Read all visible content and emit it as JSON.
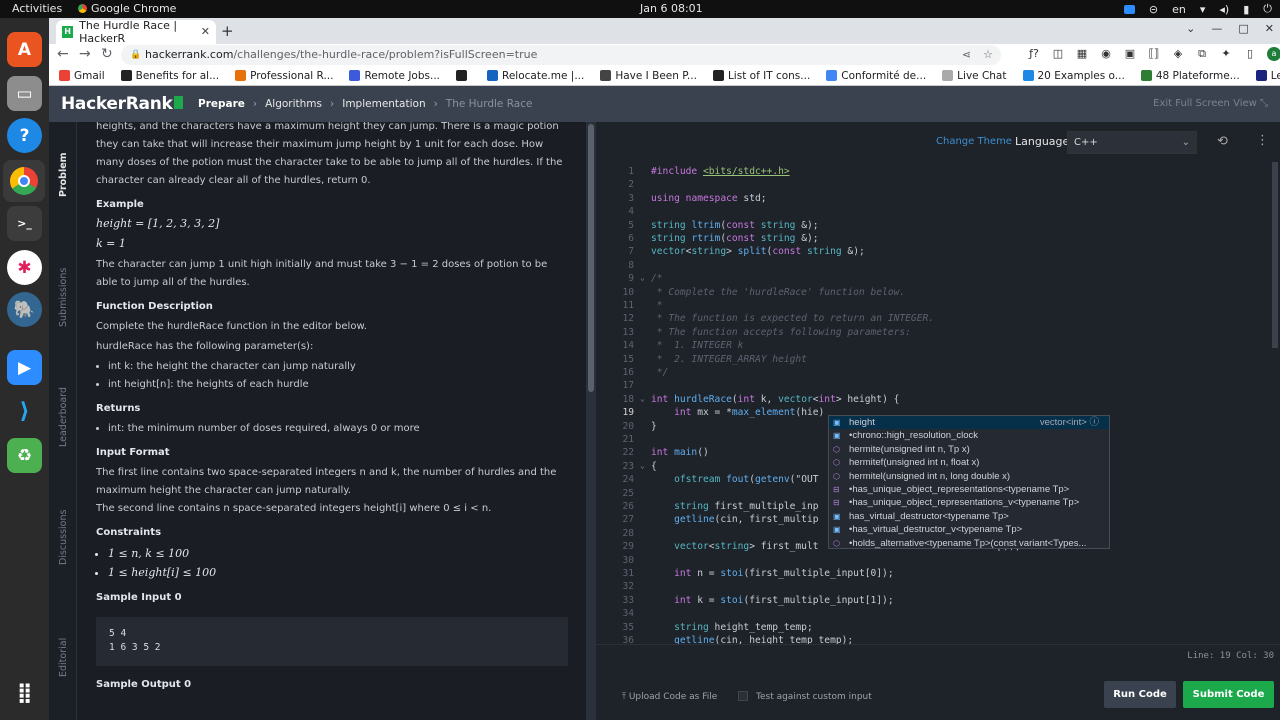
{
  "system_bar": {
    "activities": "Activities",
    "app_name": "Google Chrome",
    "clock": "Jan 6  08:01",
    "locale": "en"
  },
  "dock": {
    "items": [
      "ubuntu-software",
      "files",
      "help",
      "chrome",
      "terminal",
      "slack",
      "postgres",
      "zoom",
      "vscode",
      "trash",
      "show-apps"
    ]
  },
  "browser": {
    "tab_title": "The Hurdle Race | HackerR",
    "tab_favicon": "H",
    "url_domain": "hackerrank.com",
    "url_path": "/challenges/the-hurdle-race/problem?isFullScreen=true",
    "bookmarks": [
      "Gmail",
      "Benefits for al...",
      "Professional R...",
      "Remote Jobs...",
      "",
      "Relocate.me |...",
      "Have I Been P...",
      "List of IT cons...",
      "Conformité de...",
      "Live Chat",
      "20 Examples o...",
      "48 Plateforme...",
      "Learn"
    ],
    "bookmark_colors": [
      "#ea4335",
      "#222222",
      "#e8710a",
      "#3b5bdb",
      "#222222",
      "#1565c0",
      "#444444",
      "#222222",
      "#4285f4",
      "#aaaaaa",
      "#1e88e5",
      "#2e7d32",
      "#1a237e"
    ]
  },
  "header": {
    "logo": "HackerRank",
    "crumbs": [
      "Prepare",
      "Algorithms",
      "Implementation",
      "The Hurdle Race"
    ],
    "fullscreen": "Exit Full Screen View"
  },
  "side_tabs": [
    "Problem",
    "Submissions",
    "Leaderboard",
    "Discussions",
    "Editorial"
  ],
  "problem": {
    "intro": "heights, and the characters have a maximum height they can jump. There is a magic potion they can take that will increase their maximum jump height by 1 unit for each dose. How many doses of the potion must the character take to be able to jump all of the hurdles. If the character can already clear all of the hurdles, return 0.",
    "example_title": "Example",
    "example_height": "height = [1, 2, 3, 3, 2]",
    "example_k": "k = 1",
    "example_text": "The character can jump 1 unit high initially and must take 3 − 1 = 2 doses of potion to be able to jump all of the hurdles.",
    "func_title": "Function Description",
    "func_desc": "Complete the hurdleRace function in the editor below.",
    "params_intro": "hurdleRace has the following parameter(s):",
    "params": [
      "int k: the height the character can jump naturally",
      "int height[n]: the heights of each hurdle"
    ],
    "returns_title": "Returns",
    "returns": [
      "int: the minimum number of doses required, always 0 or more"
    ],
    "input_title": "Input Format",
    "input_line1": "The first line contains two space-separated integers n and k, the number of hurdles and the maximum height the character can jump naturally.",
    "input_line2": "The second line contains n space-separated integers height[i] where 0 ≤ i < n.",
    "constraints_title": "Constraints",
    "constraints": [
      "1 ≤ n, k ≤ 100",
      "1 ≤ height[i] ≤ 100"
    ],
    "sample_input_title": "Sample Input 0",
    "sample_input": "5 4\n1 6 3 5 2",
    "sample_output_title": "Sample Output 0"
  },
  "editor": {
    "change_theme": "Change Theme",
    "language_label": "Language",
    "language": "C++",
    "status": "Line: 19 Col: 30",
    "upload": "Upload Code as File",
    "custom_input": "Test against custom input",
    "run": "Run Code",
    "submit": "Submit Code"
  },
  "autocomplete": [
    {
      "label": "height",
      "type": "vector<int>",
      "icon": "[e]"
    },
    {
      "label": "•chrono::high_resolution_clock",
      "type": "",
      "icon": "[e]"
    },
    {
      "label": "hermite(unsigned int n, Tp x)",
      "type": "",
      "icon": "⬡"
    },
    {
      "label": "hermitef(unsigned int n, float x)",
      "type": "",
      "icon": "⬡"
    },
    {
      "label": "hermitel(unsigned int n, long double x)",
      "type": "",
      "icon": "⬡"
    },
    {
      "label": "•has_unique_object_representations<typename Tp>",
      "type": "",
      "icon": "⊟"
    },
    {
      "label": "•has_unique_object_representations_v<typename Tp>",
      "type": "",
      "icon": "⊟"
    },
    {
      "label": "has_virtual_destructor<typename Tp>",
      "type": "",
      "icon": "[e]"
    },
    {
      "label": "•has_virtual_destructor_v<typename Tp>",
      "type": "",
      "icon": "[e]"
    },
    {
      "label": "•holds_alternative<typename Tp>(const variant<Types...",
      "type": "",
      "icon": "⬡"
    }
  ],
  "code_lines": [
    {
      "n": "1",
      "t": "#include <bits/stdc++.h>"
    },
    {
      "n": "2",
      "t": ""
    },
    {
      "n": "3",
      "t": "using namespace std;"
    },
    {
      "n": "4",
      "t": ""
    },
    {
      "n": "5",
      "t": "string ltrim(const string &);"
    },
    {
      "n": "6",
      "t": "string rtrim(const string &);"
    },
    {
      "n": "7",
      "t": "vector<string> split(const string &);"
    },
    {
      "n": "8",
      "t": ""
    },
    {
      "n": "9",
      "t": "/*"
    },
    {
      "n": "10",
      "t": " * Complete the 'hurdleRace' function below."
    },
    {
      "n": "11",
      "t": " *"
    },
    {
      "n": "12",
      "t": " * The function is expected to return an INTEGER."
    },
    {
      "n": "13",
      "t": " * The function accepts following parameters:"
    },
    {
      "n": "14",
      "t": " *  1. INTEGER k"
    },
    {
      "n": "15",
      "t": " *  2. INTEGER_ARRAY height"
    },
    {
      "n": "16",
      "t": " */"
    },
    {
      "n": "17",
      "t": ""
    },
    {
      "n": "18",
      "t": "int hurdleRace(int k, vector<int> height) {"
    },
    {
      "n": "19",
      "t": "    int mx = *max_element(hie)"
    },
    {
      "n": "20",
      "t": "}"
    },
    {
      "n": "21",
      "t": ""
    },
    {
      "n": "22",
      "t": "int main()"
    },
    {
      "n": "23",
      "t": "{"
    },
    {
      "n": "24",
      "t": "    ofstream fout(getenv(\"OUT"
    },
    {
      "n": "25",
      "t": ""
    },
    {
      "n": "26",
      "t": "    string first_multiple_inp"
    },
    {
      "n": "27",
      "t": "    getline(cin, first_multip"
    },
    {
      "n": "28",
      "t": ""
    },
    {
      "n": "29",
      "t": "    vector<string> first_mult                              mp));"
    },
    {
      "n": "30",
      "t": ""
    },
    {
      "n": "31",
      "t": "    int n = stoi(first_multiple_input[0]);"
    },
    {
      "n": "32",
      "t": ""
    },
    {
      "n": "33",
      "t": "    int k = stoi(first_multiple_input[1]);"
    },
    {
      "n": "34",
      "t": ""
    },
    {
      "n": "35",
      "t": "    string height_temp_temp;"
    },
    {
      "n": "36",
      "t": "    getline(cin, height_temp_temp);"
    }
  ]
}
